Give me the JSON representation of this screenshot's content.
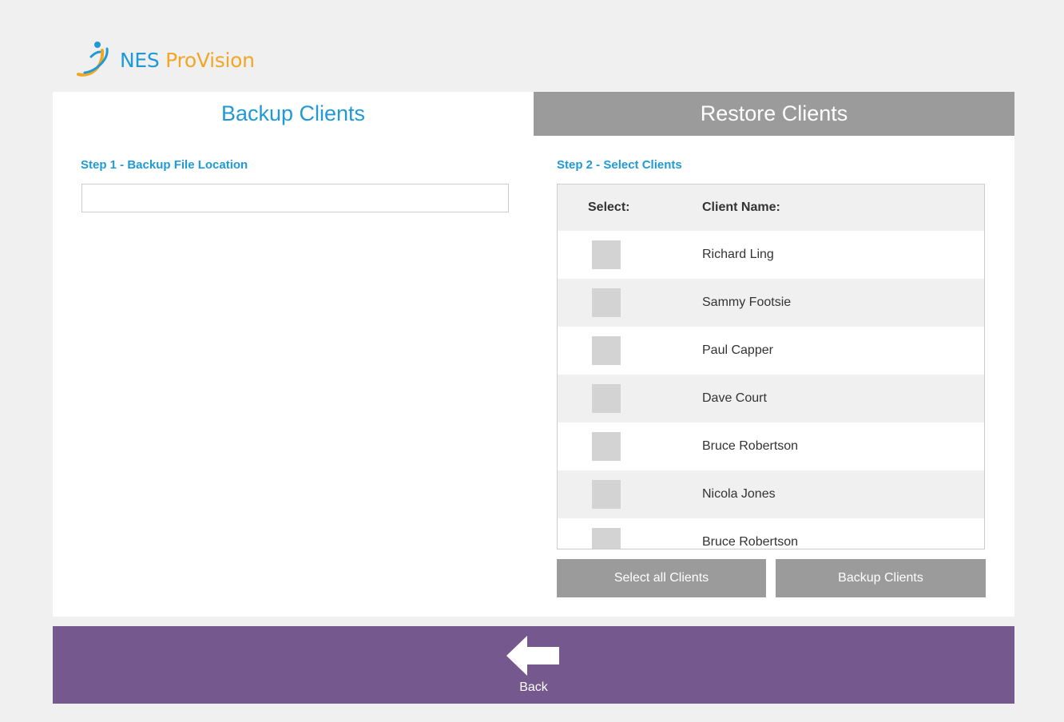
{
  "app": {
    "brand_part1": "NES",
    "brand_part2": "ProVision"
  },
  "tabs": {
    "backup": "Backup Clients",
    "restore": "Restore Clients"
  },
  "step1": {
    "label": "Step 1 - Backup File Location",
    "value": ""
  },
  "step2": {
    "label": "Step 2 - Select Clients",
    "header_select": "Select:",
    "header_name": "Client Name:",
    "clients": [
      "Richard Ling",
      "Sammy Footsie",
      "Paul Capper",
      "Dave Court",
      "Bruce Robertson",
      "Nicola Jones",
      "Bruce Robertson"
    ]
  },
  "buttons": {
    "select_all": "Select all Clients",
    "backup": "Backup Clients"
  },
  "footer": {
    "back_label": "Back"
  },
  "colors": {
    "accent_blue": "#1f9ad6",
    "accent_orange": "#f0a728",
    "footer_purple": "#75588e",
    "tab_inactive": "#9b9b9b"
  },
  "icons": {
    "logo": "nes-swirl-logo-icon",
    "back": "arrow-left-icon"
  }
}
